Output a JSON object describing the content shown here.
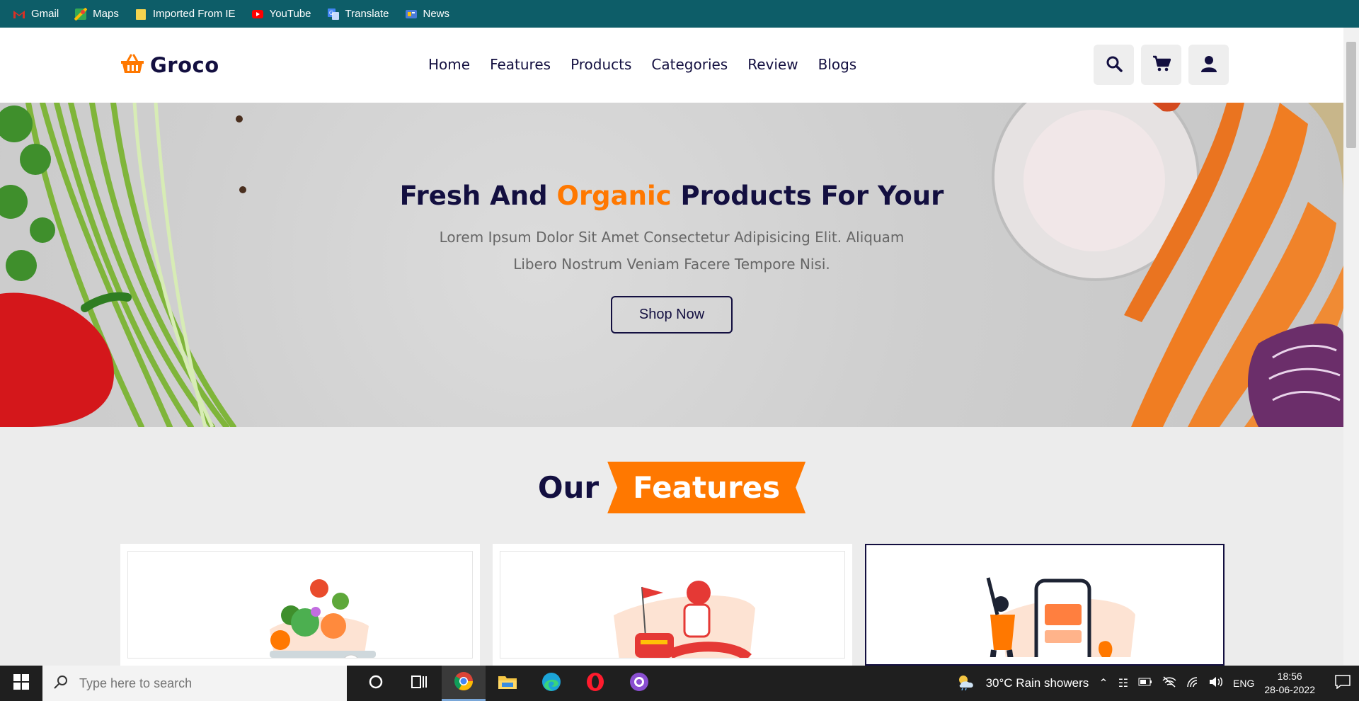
{
  "bookmarks": [
    {
      "label": "Gmail",
      "icon": "gmail-icon",
      "color": "#d93025"
    },
    {
      "label": "Maps",
      "icon": "maps-icon",
      "color": "#34a853"
    },
    {
      "label": "Imported From IE",
      "icon": "folder-icon",
      "color": "#f4d34f"
    },
    {
      "label": "YouTube",
      "icon": "youtube-icon",
      "color": "#ff0000"
    },
    {
      "label": "Translate",
      "icon": "translate-icon",
      "color": "#4285f4"
    },
    {
      "label": "News",
      "icon": "news-icon",
      "color": "#4a7bd8"
    }
  ],
  "header": {
    "logo_text": "Groco",
    "nav": [
      "Home",
      "Features",
      "Products",
      "Categories",
      "Review",
      "Blogs"
    ],
    "icons": [
      "search-icon",
      "cart-icon",
      "user-icon"
    ]
  },
  "hero": {
    "title_part1": "Fresh And ",
    "title_accent": "Organic",
    "title_part2": " Products For Your",
    "description": "Lorem Ipsum Dolor Sit Amet Consectetur Adipisicing Elit. Aliquam Libero Nostrum Veniam Facere Tempore Nisi.",
    "button": "Shop Now"
  },
  "features": {
    "heading_plain": "Our",
    "heading_badge": "Features"
  },
  "taskbar": {
    "search_placeholder": "Type here to search",
    "weather": "30°C  Rain showers",
    "lang": "ENG",
    "time": "18:56",
    "date": "28-06-2022"
  },
  "colors": {
    "brand_dark": "#130f40",
    "accent": "#ff7800",
    "bookmark_bar": "#0d5d68"
  }
}
